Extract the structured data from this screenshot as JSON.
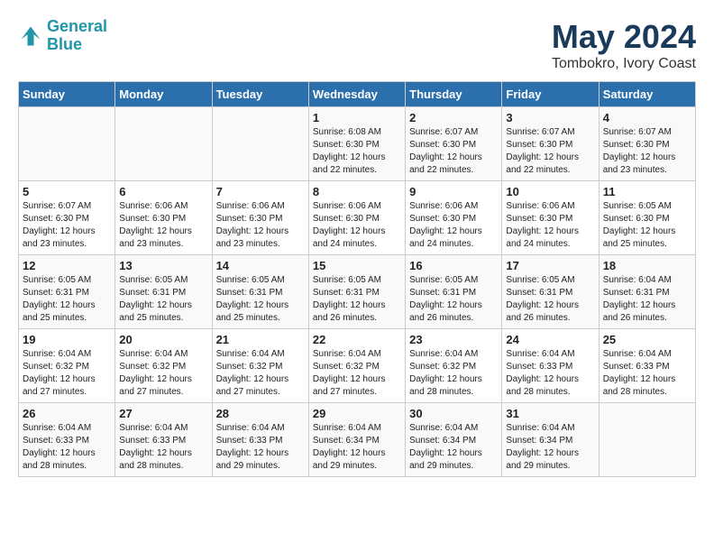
{
  "header": {
    "logo_line1": "General",
    "logo_line2": "Blue",
    "title": "May 2024",
    "subtitle": "Tombokro, Ivory Coast"
  },
  "weekdays": [
    "Sunday",
    "Monday",
    "Tuesday",
    "Wednesday",
    "Thursday",
    "Friday",
    "Saturday"
  ],
  "weeks": [
    [
      {
        "day": "",
        "info": ""
      },
      {
        "day": "",
        "info": ""
      },
      {
        "day": "",
        "info": ""
      },
      {
        "day": "1",
        "info": "Sunrise: 6:08 AM\nSunset: 6:30 PM\nDaylight: 12 hours\nand 22 minutes."
      },
      {
        "day": "2",
        "info": "Sunrise: 6:07 AM\nSunset: 6:30 PM\nDaylight: 12 hours\nand 22 minutes."
      },
      {
        "day": "3",
        "info": "Sunrise: 6:07 AM\nSunset: 6:30 PM\nDaylight: 12 hours\nand 22 minutes."
      },
      {
        "day": "4",
        "info": "Sunrise: 6:07 AM\nSunset: 6:30 PM\nDaylight: 12 hours\nand 23 minutes."
      }
    ],
    [
      {
        "day": "5",
        "info": "Sunrise: 6:07 AM\nSunset: 6:30 PM\nDaylight: 12 hours\nand 23 minutes."
      },
      {
        "day": "6",
        "info": "Sunrise: 6:06 AM\nSunset: 6:30 PM\nDaylight: 12 hours\nand 23 minutes."
      },
      {
        "day": "7",
        "info": "Sunrise: 6:06 AM\nSunset: 6:30 PM\nDaylight: 12 hours\nand 23 minutes."
      },
      {
        "day": "8",
        "info": "Sunrise: 6:06 AM\nSunset: 6:30 PM\nDaylight: 12 hours\nand 24 minutes."
      },
      {
        "day": "9",
        "info": "Sunrise: 6:06 AM\nSunset: 6:30 PM\nDaylight: 12 hours\nand 24 minutes."
      },
      {
        "day": "10",
        "info": "Sunrise: 6:06 AM\nSunset: 6:30 PM\nDaylight: 12 hours\nand 24 minutes."
      },
      {
        "day": "11",
        "info": "Sunrise: 6:05 AM\nSunset: 6:30 PM\nDaylight: 12 hours\nand 25 minutes."
      }
    ],
    [
      {
        "day": "12",
        "info": "Sunrise: 6:05 AM\nSunset: 6:31 PM\nDaylight: 12 hours\nand 25 minutes."
      },
      {
        "day": "13",
        "info": "Sunrise: 6:05 AM\nSunset: 6:31 PM\nDaylight: 12 hours\nand 25 minutes."
      },
      {
        "day": "14",
        "info": "Sunrise: 6:05 AM\nSunset: 6:31 PM\nDaylight: 12 hours\nand 25 minutes."
      },
      {
        "day": "15",
        "info": "Sunrise: 6:05 AM\nSunset: 6:31 PM\nDaylight: 12 hours\nand 26 minutes."
      },
      {
        "day": "16",
        "info": "Sunrise: 6:05 AM\nSunset: 6:31 PM\nDaylight: 12 hours\nand 26 minutes."
      },
      {
        "day": "17",
        "info": "Sunrise: 6:05 AM\nSunset: 6:31 PM\nDaylight: 12 hours\nand 26 minutes."
      },
      {
        "day": "18",
        "info": "Sunrise: 6:04 AM\nSunset: 6:31 PM\nDaylight: 12 hours\nand 26 minutes."
      }
    ],
    [
      {
        "day": "19",
        "info": "Sunrise: 6:04 AM\nSunset: 6:32 PM\nDaylight: 12 hours\nand 27 minutes."
      },
      {
        "day": "20",
        "info": "Sunrise: 6:04 AM\nSunset: 6:32 PM\nDaylight: 12 hours\nand 27 minutes."
      },
      {
        "day": "21",
        "info": "Sunrise: 6:04 AM\nSunset: 6:32 PM\nDaylight: 12 hours\nand 27 minutes."
      },
      {
        "day": "22",
        "info": "Sunrise: 6:04 AM\nSunset: 6:32 PM\nDaylight: 12 hours\nand 27 minutes."
      },
      {
        "day": "23",
        "info": "Sunrise: 6:04 AM\nSunset: 6:32 PM\nDaylight: 12 hours\nand 28 minutes."
      },
      {
        "day": "24",
        "info": "Sunrise: 6:04 AM\nSunset: 6:33 PM\nDaylight: 12 hours\nand 28 minutes."
      },
      {
        "day": "25",
        "info": "Sunrise: 6:04 AM\nSunset: 6:33 PM\nDaylight: 12 hours\nand 28 minutes."
      }
    ],
    [
      {
        "day": "26",
        "info": "Sunrise: 6:04 AM\nSunset: 6:33 PM\nDaylight: 12 hours\nand 28 minutes."
      },
      {
        "day": "27",
        "info": "Sunrise: 6:04 AM\nSunset: 6:33 PM\nDaylight: 12 hours\nand 28 minutes."
      },
      {
        "day": "28",
        "info": "Sunrise: 6:04 AM\nSunset: 6:33 PM\nDaylight: 12 hours\nand 29 minutes."
      },
      {
        "day": "29",
        "info": "Sunrise: 6:04 AM\nSunset: 6:34 PM\nDaylight: 12 hours\nand 29 minutes."
      },
      {
        "day": "30",
        "info": "Sunrise: 6:04 AM\nSunset: 6:34 PM\nDaylight: 12 hours\nand 29 minutes."
      },
      {
        "day": "31",
        "info": "Sunrise: 6:04 AM\nSunset: 6:34 PM\nDaylight: 12 hours\nand 29 minutes."
      },
      {
        "day": "",
        "info": ""
      }
    ]
  ]
}
